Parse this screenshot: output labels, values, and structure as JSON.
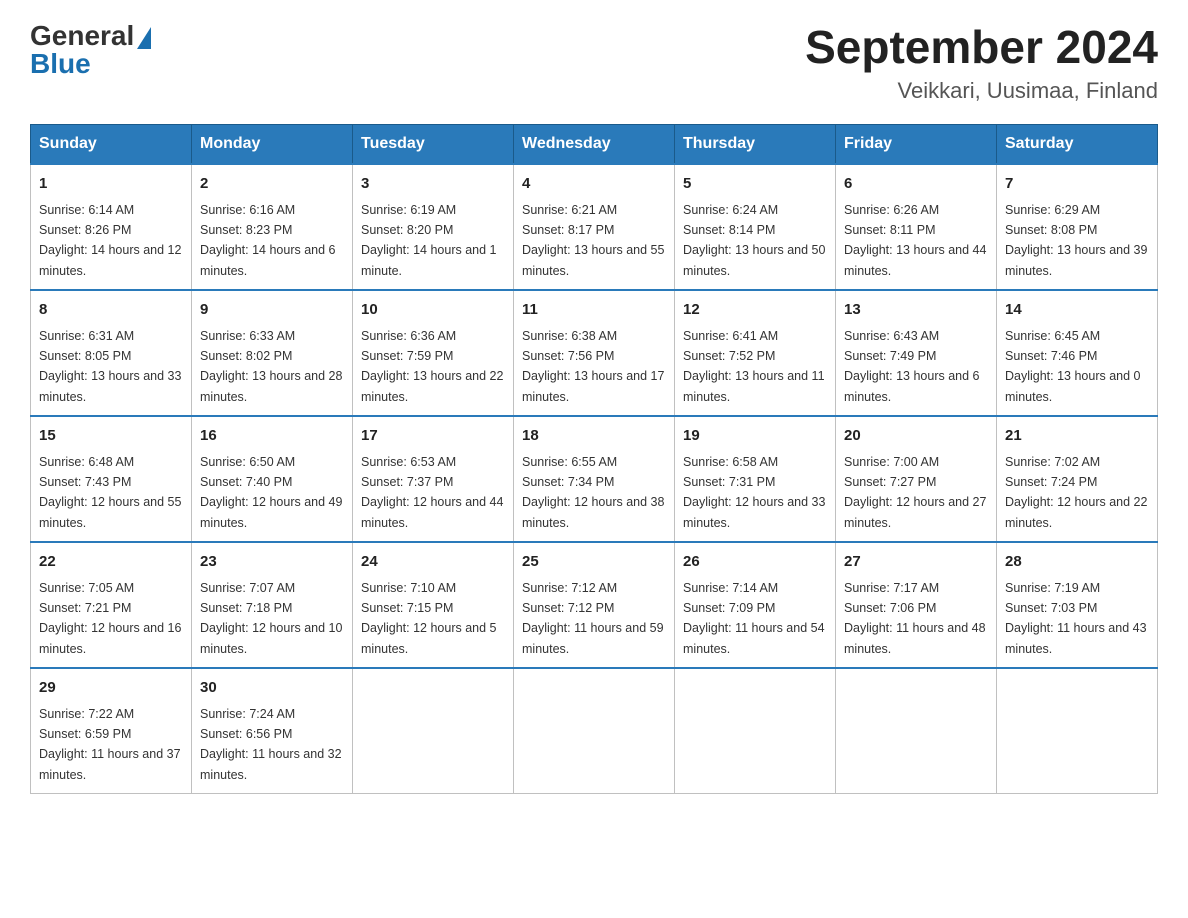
{
  "logo": {
    "general": "General",
    "blue": "Blue"
  },
  "title": {
    "month_year": "September 2024",
    "location": "Veikkari, Uusimaa, Finland"
  },
  "headers": [
    "Sunday",
    "Monday",
    "Tuesday",
    "Wednesday",
    "Thursday",
    "Friday",
    "Saturday"
  ],
  "weeks": [
    [
      {
        "day": "1",
        "sunrise": "6:14 AM",
        "sunset": "8:26 PM",
        "daylight": "14 hours and 12 minutes."
      },
      {
        "day": "2",
        "sunrise": "6:16 AM",
        "sunset": "8:23 PM",
        "daylight": "14 hours and 6 minutes."
      },
      {
        "day": "3",
        "sunrise": "6:19 AM",
        "sunset": "8:20 PM",
        "daylight": "14 hours and 1 minute."
      },
      {
        "day": "4",
        "sunrise": "6:21 AM",
        "sunset": "8:17 PM",
        "daylight": "13 hours and 55 minutes."
      },
      {
        "day": "5",
        "sunrise": "6:24 AM",
        "sunset": "8:14 PM",
        "daylight": "13 hours and 50 minutes."
      },
      {
        "day": "6",
        "sunrise": "6:26 AM",
        "sunset": "8:11 PM",
        "daylight": "13 hours and 44 minutes."
      },
      {
        "day": "7",
        "sunrise": "6:29 AM",
        "sunset": "8:08 PM",
        "daylight": "13 hours and 39 minutes."
      }
    ],
    [
      {
        "day": "8",
        "sunrise": "6:31 AM",
        "sunset": "8:05 PM",
        "daylight": "13 hours and 33 minutes."
      },
      {
        "day": "9",
        "sunrise": "6:33 AM",
        "sunset": "8:02 PM",
        "daylight": "13 hours and 28 minutes."
      },
      {
        "day": "10",
        "sunrise": "6:36 AM",
        "sunset": "7:59 PM",
        "daylight": "13 hours and 22 minutes."
      },
      {
        "day": "11",
        "sunrise": "6:38 AM",
        "sunset": "7:56 PM",
        "daylight": "13 hours and 17 minutes."
      },
      {
        "day": "12",
        "sunrise": "6:41 AM",
        "sunset": "7:52 PM",
        "daylight": "13 hours and 11 minutes."
      },
      {
        "day": "13",
        "sunrise": "6:43 AM",
        "sunset": "7:49 PM",
        "daylight": "13 hours and 6 minutes."
      },
      {
        "day": "14",
        "sunrise": "6:45 AM",
        "sunset": "7:46 PM",
        "daylight": "13 hours and 0 minutes."
      }
    ],
    [
      {
        "day": "15",
        "sunrise": "6:48 AM",
        "sunset": "7:43 PM",
        "daylight": "12 hours and 55 minutes."
      },
      {
        "day": "16",
        "sunrise": "6:50 AM",
        "sunset": "7:40 PM",
        "daylight": "12 hours and 49 minutes."
      },
      {
        "day": "17",
        "sunrise": "6:53 AM",
        "sunset": "7:37 PM",
        "daylight": "12 hours and 44 minutes."
      },
      {
        "day": "18",
        "sunrise": "6:55 AM",
        "sunset": "7:34 PM",
        "daylight": "12 hours and 38 minutes."
      },
      {
        "day": "19",
        "sunrise": "6:58 AM",
        "sunset": "7:31 PM",
        "daylight": "12 hours and 33 minutes."
      },
      {
        "day": "20",
        "sunrise": "7:00 AM",
        "sunset": "7:27 PM",
        "daylight": "12 hours and 27 minutes."
      },
      {
        "day": "21",
        "sunrise": "7:02 AM",
        "sunset": "7:24 PM",
        "daylight": "12 hours and 22 minutes."
      }
    ],
    [
      {
        "day": "22",
        "sunrise": "7:05 AM",
        "sunset": "7:21 PM",
        "daylight": "12 hours and 16 minutes."
      },
      {
        "day": "23",
        "sunrise": "7:07 AM",
        "sunset": "7:18 PM",
        "daylight": "12 hours and 10 minutes."
      },
      {
        "day": "24",
        "sunrise": "7:10 AM",
        "sunset": "7:15 PM",
        "daylight": "12 hours and 5 minutes."
      },
      {
        "day": "25",
        "sunrise": "7:12 AM",
        "sunset": "7:12 PM",
        "daylight": "11 hours and 59 minutes."
      },
      {
        "day": "26",
        "sunrise": "7:14 AM",
        "sunset": "7:09 PM",
        "daylight": "11 hours and 54 minutes."
      },
      {
        "day": "27",
        "sunrise": "7:17 AM",
        "sunset": "7:06 PM",
        "daylight": "11 hours and 48 minutes."
      },
      {
        "day": "28",
        "sunrise": "7:19 AM",
        "sunset": "7:03 PM",
        "daylight": "11 hours and 43 minutes."
      }
    ],
    [
      {
        "day": "29",
        "sunrise": "7:22 AM",
        "sunset": "6:59 PM",
        "daylight": "11 hours and 37 minutes."
      },
      {
        "day": "30",
        "sunrise": "7:24 AM",
        "sunset": "6:56 PM",
        "daylight": "11 hours and 32 minutes."
      },
      null,
      null,
      null,
      null,
      null
    ]
  ]
}
